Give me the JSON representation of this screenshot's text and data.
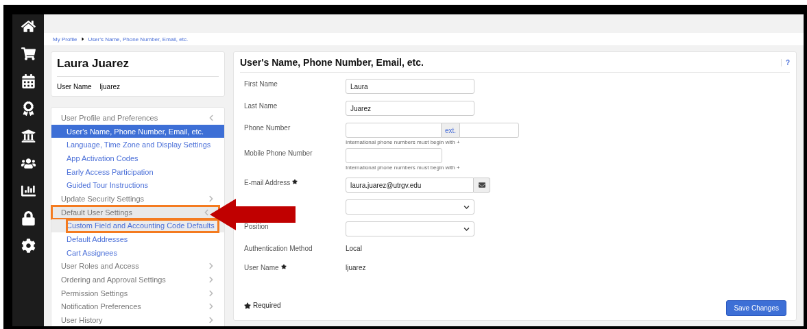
{
  "breadcrumb": [
    {
      "label": "My Profile"
    },
    {
      "label": "User's Name, Phone Number, Email, etc."
    }
  ],
  "profile": {
    "name": "Laura Juarez",
    "user_name_label": "User Name",
    "user_name": "ljuarez"
  },
  "menu": [
    {
      "label": "User Profile and Preferences",
      "expanded": true,
      "hovered": false,
      "annotated": false,
      "children": [
        {
          "label": "User's Name, Phone Number, Email, etc.",
          "selected": true,
          "hovered": false,
          "annotated": false
        },
        {
          "label": "Language, Time Zone and Display Settings",
          "selected": false,
          "hovered": false,
          "annotated": false
        },
        {
          "label": "App Activation Codes",
          "selected": false,
          "hovered": false,
          "annotated": false
        },
        {
          "label": "Early Access Participation",
          "selected": false,
          "hovered": false,
          "annotated": false
        },
        {
          "label": "Guided Tour Instructions",
          "selected": false,
          "hovered": false,
          "annotated": false
        }
      ]
    },
    {
      "label": "Update Security Settings",
      "expanded": false,
      "hovered": false,
      "annotated": false
    },
    {
      "label": "Default User Settings",
      "expanded": true,
      "hovered": true,
      "annotated": true,
      "children": [
        {
          "label": "Custom Field and Accounting Code Defaults",
          "selected": false,
          "hovered": true,
          "annotated": true
        },
        {
          "label": "Default Addresses",
          "selected": false,
          "hovered": false,
          "annotated": false
        },
        {
          "label": "Cart Assignees",
          "selected": false,
          "hovered": false,
          "annotated": false
        }
      ]
    },
    {
      "label": "User Roles and Access",
      "expanded": false,
      "hovered": false,
      "annotated": false
    },
    {
      "label": "Ordering and Approval Settings",
      "expanded": false,
      "hovered": false,
      "annotated": false
    },
    {
      "label": "Permission Settings",
      "expanded": false,
      "hovered": false,
      "annotated": false
    },
    {
      "label": "Notification Preferences",
      "expanded": false,
      "hovered": false,
      "annotated": false
    },
    {
      "label": "User History",
      "expanded": false,
      "hovered": false,
      "annotated": false
    }
  ],
  "pointer_arrow": true,
  "panel": {
    "title": "User's Name, Phone Number, Email, etc.",
    "help": "?",
    "fields": [
      {
        "kind": "text",
        "label": "First Name",
        "required": false,
        "value": "Laura"
      },
      {
        "kind": "text",
        "label": "Last Name",
        "required": false,
        "value": "Juarez"
      },
      {
        "kind": "phone",
        "label": "Phone Number",
        "required": false,
        "addon": "ext.",
        "hint": "International phone numbers must begin with +"
      },
      {
        "kind": "mobile",
        "label": "Mobile Phone Number",
        "required": false,
        "hint": "International phone numbers must begin with +"
      },
      {
        "kind": "email",
        "label": "E-mail Address",
        "required": true,
        "value": "laura.juarez@utrgv.edu"
      },
      {
        "kind": "select"
      },
      {
        "kind": "select",
        "label": "Position"
      },
      {
        "kind": "static",
        "label": "Authentication Method",
        "required": false,
        "value": "Local"
      },
      {
        "kind": "static",
        "label": "User Name",
        "required": true,
        "value": "ljuarez"
      }
    ],
    "required_note": "Required",
    "save": "Save Changes"
  }
}
